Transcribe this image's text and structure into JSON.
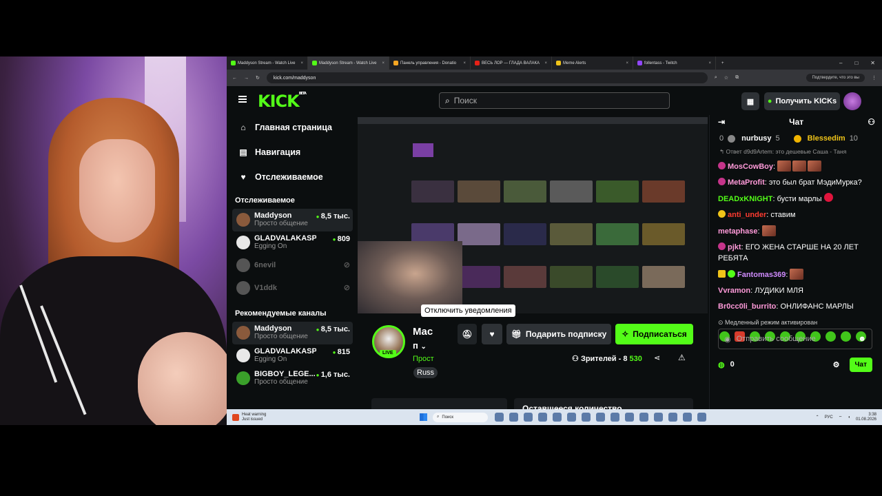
{
  "browser": {
    "tabs": [
      {
        "title": "Maddyson Stream - Watch Live",
        "icon": "kick-favicon",
        "color": "#53fc18"
      },
      {
        "title": "Maddyson Stream - Watch Live",
        "icon": "kick-favicon",
        "color": "#53fc18",
        "active": true
      },
      {
        "title": "Панель управления - Donatio",
        "icon": "donation-favicon",
        "color": "#f5a623"
      },
      {
        "title": "ВЕСЬ ЛОР — ГЛАДА ВАЛАКА",
        "icon": "youtube-favicon",
        "color": "#e62117"
      },
      {
        "title": "Meme Alerts",
        "icon": "memealerts-favicon",
        "color": "#f0c419"
      },
      {
        "title": "follentass - Twitch",
        "icon": "twitch-favicon",
        "color": "#9146ff"
      }
    ],
    "url": "kick.com/maddyson",
    "profile_button": "Подтвердите, что это вы"
  },
  "kick": {
    "logo": "KICK",
    "logo_beta": "BETA",
    "search_placeholder": "Поиск",
    "get_kicks": "Получить KICKs",
    "nav": [
      {
        "label": "Главная страница",
        "icon": "home-icon"
      },
      {
        "label": "Навигация",
        "icon": "compass-icon"
      },
      {
        "label": "Отслеживаемое",
        "icon": "heart-icon"
      }
    ],
    "following_heading": "Отслеживаемое",
    "following": [
      {
        "name": "Maddyson",
        "category": "Просто общение",
        "viewers": "8,5 тыс.",
        "live": true,
        "color": "#8a5a3c"
      },
      {
        "name": "GLADVALAKASP...",
        "category": "Egging On",
        "viewers": "809",
        "live": true,
        "color": "#e8e8e8"
      },
      {
        "name": "6nevil",
        "category": "",
        "viewers": "",
        "live": false,
        "color": "#555"
      },
      {
        "name": "V1ddk",
        "category": "",
        "viewers": "",
        "live": false,
        "color": "#555"
      }
    ],
    "recommended_heading": "Рекомендуемые каналы",
    "recommended": [
      {
        "name": "Maddyson",
        "category": "Просто общение",
        "viewers": "8,5 тыс.",
        "color": "#8a5a3c"
      },
      {
        "name": "GLADVALAKASPW...",
        "category": "Egging On",
        "viewers": "815",
        "color": "#e8e8e8"
      },
      {
        "name": "BIGBOY_LEGE...",
        "category": "Просто общение",
        "viewers": "1,6 тыс.",
        "color": "#3aa02a"
      }
    ],
    "tooltip": "Отключить уведомления",
    "streamer": {
      "name": "Mac",
      "line2": "п",
      "category": "Прост",
      "tag": "Russ",
      "live_badge": "LIVE",
      "viewers_label": "Зрителей - 8",
      "viewers_value": "530"
    },
    "buttons": {
      "gift": "Подарить подписку",
      "subscribe": "Подписаться"
    },
    "remaining_card": "Оставшееся количество"
  },
  "chat": {
    "title": "Чат",
    "pinned": [
      {
        "rank": "0",
        "user": "nurbusy",
        "count": "5"
      },
      {
        "rank": "1",
        "user": "Blessedim",
        "count": "10"
      }
    ],
    "reply": "Ответ d9d9Artem: это дешевые Саша - Таня",
    "messages": [
      {
        "user": "MosCowBoy",
        "color": "#ff9ad9",
        "text": "",
        "emotes": 3
      },
      {
        "user": "MetaProfit",
        "color": "#ff9ad9",
        "text": "это был брат МэдиМурка?",
        "emotes": 0
      },
      {
        "user": "DEADxKNIGHT",
        "color": "#53fc18",
        "text": "бусти марлы",
        "emotes": 0
      },
      {
        "user": "anti_under",
        "color": "#ff3b30",
        "text": "ставим",
        "emotes": 0
      },
      {
        "user": "metaphase",
        "color": "#ff9ad9",
        "text": "",
        "emotes": 1
      },
      {
        "user": "pjkt",
        "color": "#ff9ad9",
        "text": "ЕГО ЖЕНА СТАРШЕ НА 20 ЛЕТ РЕБЯТА",
        "emotes": 0
      },
      {
        "user": "Fantomas369",
        "color": "#d18cff",
        "text": "",
        "emotes": 1
      },
      {
        "user": "Vvramon",
        "color": "#ff9ad9",
        "text": "ЛУДИКИ МЛЯ",
        "emotes": 0
      },
      {
        "user": "Br0cc0li_burrito",
        "color": "#ff9ad9",
        "text": "ОНЛИФАНС МАРЛЫ",
        "emotes": 0
      }
    ],
    "slow_mode": "Медленный режим активирован",
    "input_placeholder": "Отправить сообщение",
    "kicks_count": "0",
    "send_label": "Чат"
  },
  "taskbar": {
    "warning_title": "Heat warning",
    "warning_sub": "Just issued",
    "search": "Поиск",
    "lang": "РУС",
    "time": "3:38",
    "date": "01.08.2026"
  }
}
